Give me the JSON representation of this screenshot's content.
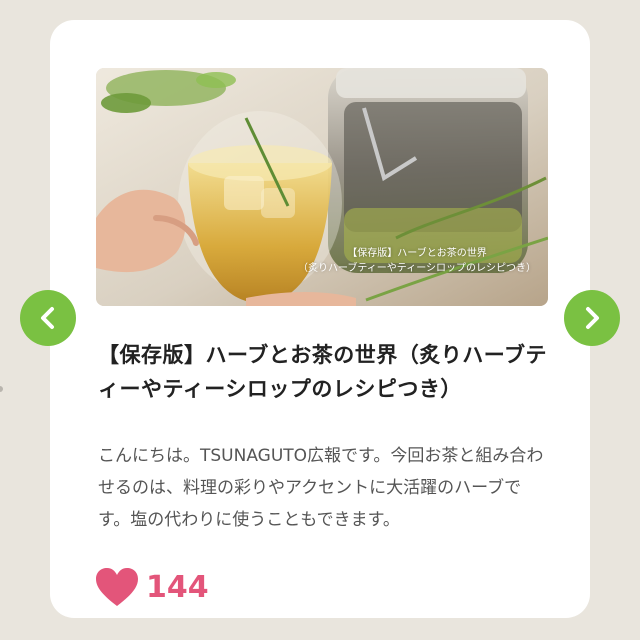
{
  "article": {
    "image_caption_line1": "【保存版】ハーブとお茶の世界",
    "image_caption_line2": "（炙りハーブティーやティーシロップのレシピつき）",
    "title": "【保存版】ハーブとお茶の世界（炙りハーブティーやティーシロップのレシピつき）",
    "excerpt": "こんにちは。TSUNAGUTO広報です。今回お茶と組み合わせるのは、料理の彩りやアクセントに大活躍のハーブです。塩の代わりに使うこともできます。",
    "likes": "144"
  },
  "carousel": {
    "prev_icon": "chevron-left-icon",
    "next_icon": "chevron-right-icon"
  },
  "colors": {
    "accent_green": "#7ac142",
    "heart_pink": "#e3557a",
    "page_bg": "#e9e5dd",
    "card_bg": "#ffffff"
  }
}
